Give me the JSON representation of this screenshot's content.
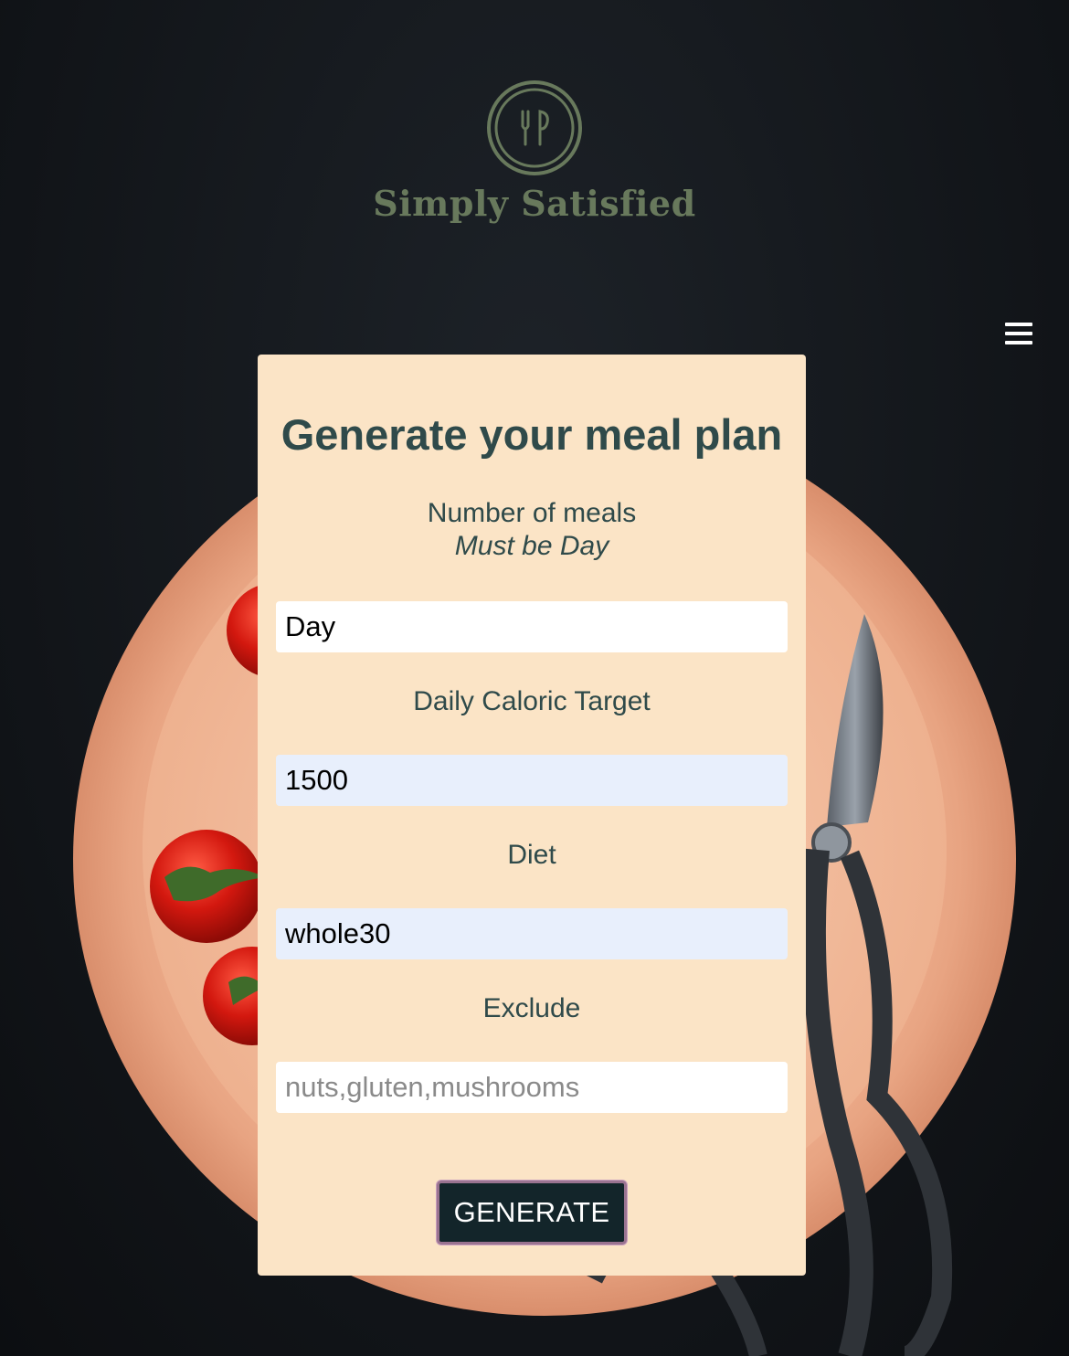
{
  "brand": {
    "name": "Simply Satisfied",
    "logo_icon": "fork-spoon-icon",
    "color": "#68795c"
  },
  "nav": {
    "menu_icon": "hamburger-menu-icon"
  },
  "form": {
    "title": "Generate your meal plan",
    "meals": {
      "label": "Number of meals",
      "hint": "Must be Day",
      "value": "Day"
    },
    "calories": {
      "label": "Daily Caloric Target",
      "value": "1500"
    },
    "diet": {
      "label": "Diet",
      "value": "whole30"
    },
    "exclude": {
      "label": "Exclude",
      "value": "",
      "placeholder": "nuts,gluten,mushrooms"
    },
    "submit_label": "GENERATE"
  },
  "colors": {
    "card_bg": "#fbe4c6",
    "text": "#2f4a4a",
    "button_bg": "#13252a",
    "button_border": "#9a7390",
    "autofill_bg": "#e8effc"
  },
  "background": "dark-table-with-clay-plate-tomatoes-and-shears"
}
